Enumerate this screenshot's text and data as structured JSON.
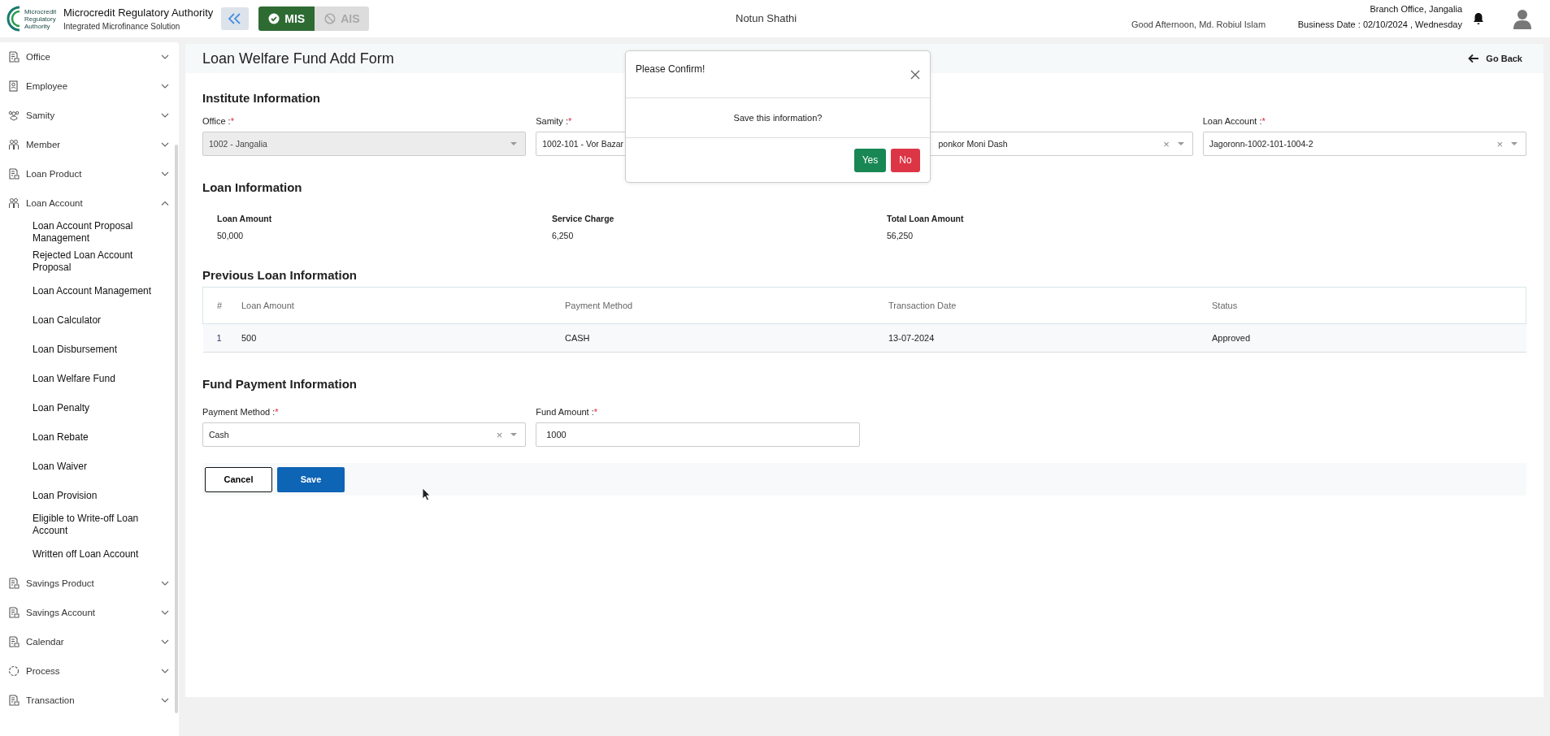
{
  "header": {
    "org_name": "Microcredit Regulatory Authority",
    "org_subtitle": "Integrated Microfinance Solution",
    "logo_text": "Microcredit Regulatory Authority",
    "modules": [
      {
        "label": "MIS",
        "selected": true
      },
      {
        "label": "AIS",
        "selected": false
      }
    ],
    "app_name": "Notun Shathi",
    "greeting": "Good Afternoon, Md. Robiul Islam",
    "branch": "Branch Office, Jangalia",
    "business_date": "Business Date : 02/10/2024 , Wednesday"
  },
  "sidebar": {
    "items": [
      {
        "label": "Office",
        "kind": "document",
        "expanded": false
      },
      {
        "label": "Employee",
        "kind": "badge",
        "expanded": false
      },
      {
        "label": "Samity",
        "kind": "group",
        "expanded": false
      },
      {
        "label": "Member",
        "kind": "people",
        "expanded": false
      },
      {
        "label": "Loan Product",
        "kind": "document",
        "expanded": false
      },
      {
        "label": "Loan Account",
        "kind": "people",
        "expanded": true,
        "children": [
          {
            "label": "Loan Account Proposal Management"
          },
          {
            "label": "Rejected Loan Account Proposal"
          },
          {
            "label": "Loan Account Management"
          },
          {
            "label": "Loan Calculator"
          },
          {
            "label": "Loan Disbursement"
          },
          {
            "label": "Loan Welfare Fund"
          },
          {
            "label": "Loan Penalty"
          },
          {
            "label": "Loan Rebate"
          },
          {
            "label": "Loan Waiver"
          },
          {
            "label": "Loan Provision"
          },
          {
            "label": "Eligible to Write-off Loan Account"
          },
          {
            "label": "Written off Loan Account"
          }
        ]
      },
      {
        "label": "Savings Product",
        "kind": "document",
        "expanded": false
      },
      {
        "label": "Savings Account",
        "kind": "document",
        "expanded": false
      },
      {
        "label": "Calendar",
        "kind": "document",
        "expanded": false
      },
      {
        "label": "Process",
        "kind": "cycle",
        "expanded": false
      },
      {
        "label": "Transaction",
        "kind": "document",
        "expanded": false
      }
    ]
  },
  "page": {
    "title": "Loan Welfare Fund Add Form",
    "back": "Go Back"
  },
  "institute": {
    "heading": "Institute Information",
    "fields": [
      {
        "label": "Office :",
        "required_mark": "*",
        "value": "1002 - Jangalia",
        "disabled": true
      },
      {
        "label": "Samity :",
        "required_mark": "*",
        "value": "1002-101 - Vor Bazar",
        "disabled": false
      },
      {
        "value": "ponkor Moni Dash",
        "clear": "×",
        "disabled": false
      },
      {
        "label": "Loan Account :",
        "required_mark": "*",
        "value": "Jagoronn-1002-101-1004-2",
        "clear": "×",
        "disabled": false
      }
    ]
  },
  "loan_info": {
    "heading": "Loan Information",
    "items": [
      {
        "label": "Loan Amount",
        "value": "50,000"
      },
      {
        "label": "Service Charge",
        "value": "6,250"
      },
      {
        "label": "Total Loan Amount",
        "value": "56,250"
      }
    ]
  },
  "previous": {
    "heading": "Previous Loan Information",
    "columns": [
      "#",
      "Loan Amount",
      "Payment Method",
      "Transaction Date",
      "Status"
    ],
    "rows": [
      [
        "1",
        "500",
        "CASH",
        "13-07-2024",
        "Approved"
      ]
    ]
  },
  "fund": {
    "heading": "Fund Payment Information",
    "payment_method": {
      "label": "Payment Method :",
      "required_mark": "*",
      "value": "Cash",
      "clear": "×"
    },
    "fund_amount": {
      "label": "Fund Amount :",
      "required_mark": "*",
      "value": "1000"
    }
  },
  "actions": {
    "cancel": "Cancel",
    "save": "Save"
  },
  "dialog": {
    "title": "Please Confirm!",
    "message": "Save this information?",
    "yes": "Yes",
    "no": "No"
  }
}
